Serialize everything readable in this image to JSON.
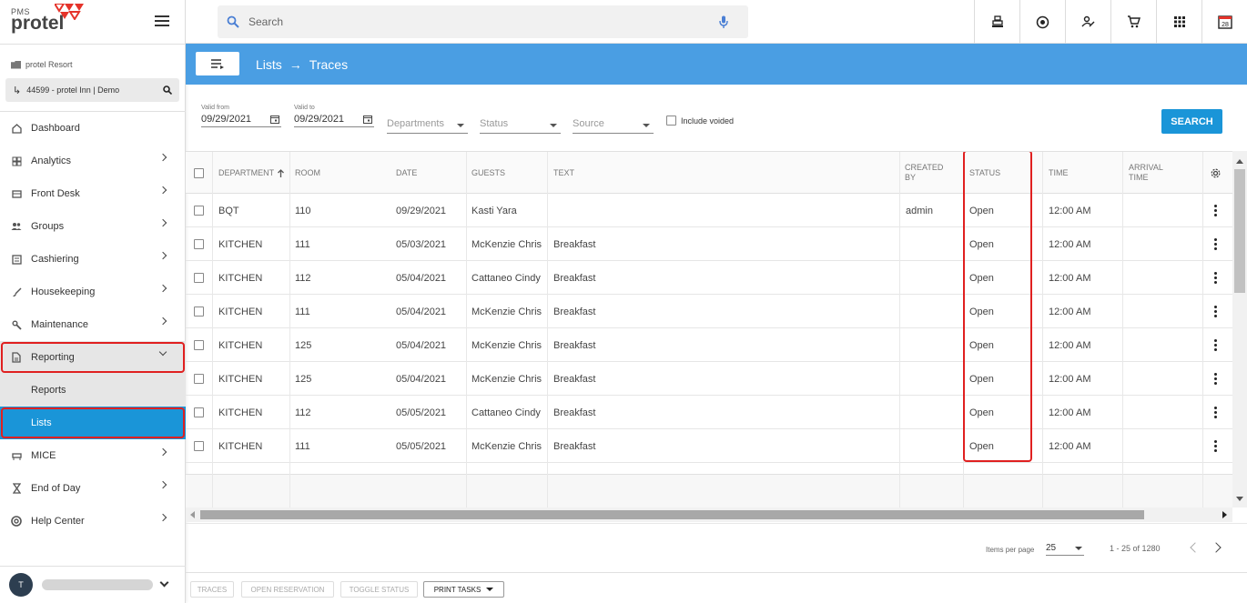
{
  "logo": {
    "pms": "PMS",
    "brand": "protel"
  },
  "resort_label": "protel Resort",
  "property_select": "44599 - protel Inn | Demo",
  "nav": [
    {
      "label": "Dashboard",
      "icon": "home-icon",
      "chevron": false
    },
    {
      "label": "Analytics",
      "icon": "dashboard-icon",
      "chevron": true
    },
    {
      "label": "Front Desk",
      "icon": "front-desk-icon",
      "chevron": true
    },
    {
      "label": "Groups",
      "icon": "groups-icon",
      "chevron": true
    },
    {
      "label": "Cashiering",
      "icon": "cashiering-icon",
      "chevron": true
    },
    {
      "label": "Housekeeping",
      "icon": "broom-icon",
      "chevron": true
    },
    {
      "label": "Maintenance",
      "icon": "wrench-icon",
      "chevron": true
    },
    {
      "label": "Reporting",
      "icon": "report-icon",
      "chevron": true
    },
    {
      "label": "MICE",
      "icon": "mice-icon",
      "chevron": true
    },
    {
      "label": "End of Day",
      "icon": "hourglass-icon",
      "chevron": true
    },
    {
      "label": "Help Center",
      "icon": "help-icon",
      "chevron": true
    }
  ],
  "nav_sub": [
    {
      "label": "Reports"
    },
    {
      "label": "Lists"
    }
  ],
  "user": {
    "initial": "T"
  },
  "search": {
    "placeholder": "Search"
  },
  "top_icons": [
    "cashbox-icon",
    "record-icon",
    "sign-icon",
    "cart-icon",
    "apps-icon",
    "calendar-icon"
  ],
  "calendar_day": "28",
  "breadcrumb": {
    "first": "Lists",
    "arrow": "→",
    "second": "Traces"
  },
  "filters": {
    "valid_from_label": "Valid from",
    "valid_from": "09/29/2021",
    "valid_to_label": "Valid to",
    "valid_to": "09/29/2021",
    "departments": "Departments",
    "status": "Status",
    "source": "Source",
    "include_voided": "Include voided",
    "search_button": "SEARCH"
  },
  "columns": {
    "department": "DEPARTMENT",
    "room": "ROOM",
    "date": "DATE",
    "guests": "GUESTS",
    "text": "TEXT",
    "created_by_1": "CREATED",
    "created_by_2": "BY",
    "status": "STATUS",
    "time": "TIME",
    "arrival_1": "ARRIVAL",
    "arrival_2": "TIME"
  },
  "rows": [
    {
      "department": "BQT",
      "room": "110",
      "date": "09/29/2021",
      "guests": "Kasti Yara",
      "text": "",
      "created_by": "admin",
      "status": "Open",
      "time": "12:00 AM",
      "arrival": ""
    },
    {
      "department": "KITCHEN",
      "room": "111",
      "date": "05/03/2021",
      "guests": "McKenzie Chris",
      "text": "Breakfast",
      "created_by": "",
      "status": "Open",
      "time": "12:00 AM",
      "arrival": ""
    },
    {
      "department": "KITCHEN",
      "room": "112",
      "date": "05/04/2021",
      "guests": "Cattaneo Cindy",
      "text": "Breakfast",
      "created_by": "",
      "status": "Open",
      "time": "12:00 AM",
      "arrival": ""
    },
    {
      "department": "KITCHEN",
      "room": "111",
      "date": "05/04/2021",
      "guests": "McKenzie Chris",
      "text": "Breakfast",
      "created_by": "",
      "status": "Open",
      "time": "12:00 AM",
      "arrival": ""
    },
    {
      "department": "KITCHEN",
      "room": "125",
      "date": "05/04/2021",
      "guests": "McKenzie Chris",
      "text": "Breakfast",
      "created_by": "",
      "status": "Open",
      "time": "12:00 AM",
      "arrival": ""
    },
    {
      "department": "KITCHEN",
      "room": "125",
      "date": "05/04/2021",
      "guests": "McKenzie Chris",
      "text": "Breakfast",
      "created_by": "",
      "status": "Open",
      "time": "12:00 AM",
      "arrival": ""
    },
    {
      "department": "KITCHEN",
      "room": "112",
      "date": "05/05/2021",
      "guests": "Cattaneo Cindy",
      "text": "Breakfast",
      "created_by": "",
      "status": "Open",
      "time": "12:00 AM",
      "arrival": ""
    },
    {
      "department": "KITCHEN",
      "room": "111",
      "date": "05/05/2021",
      "guests": "McKenzie Chris",
      "text": "Breakfast",
      "created_by": "",
      "status": "Open",
      "time": "12:00 AM",
      "arrival": ""
    }
  ],
  "pager": {
    "items_per_page_label": "Items per page",
    "items_per_page": "25",
    "range": "1 - 25 of 1280"
  },
  "actions": [
    {
      "label": "TRACES",
      "enabled": false
    },
    {
      "label": "OPEN RESERVATION",
      "enabled": false
    },
    {
      "label": "TOGGLE STATUS",
      "enabled": false
    },
    {
      "label": "PRINT TASKS",
      "enabled": true
    }
  ],
  "colors": {
    "accent": "#1a95d8",
    "header_blue": "#4a9ee3",
    "highlight_red": "#e02020",
    "brand_red": "#e5332a"
  }
}
